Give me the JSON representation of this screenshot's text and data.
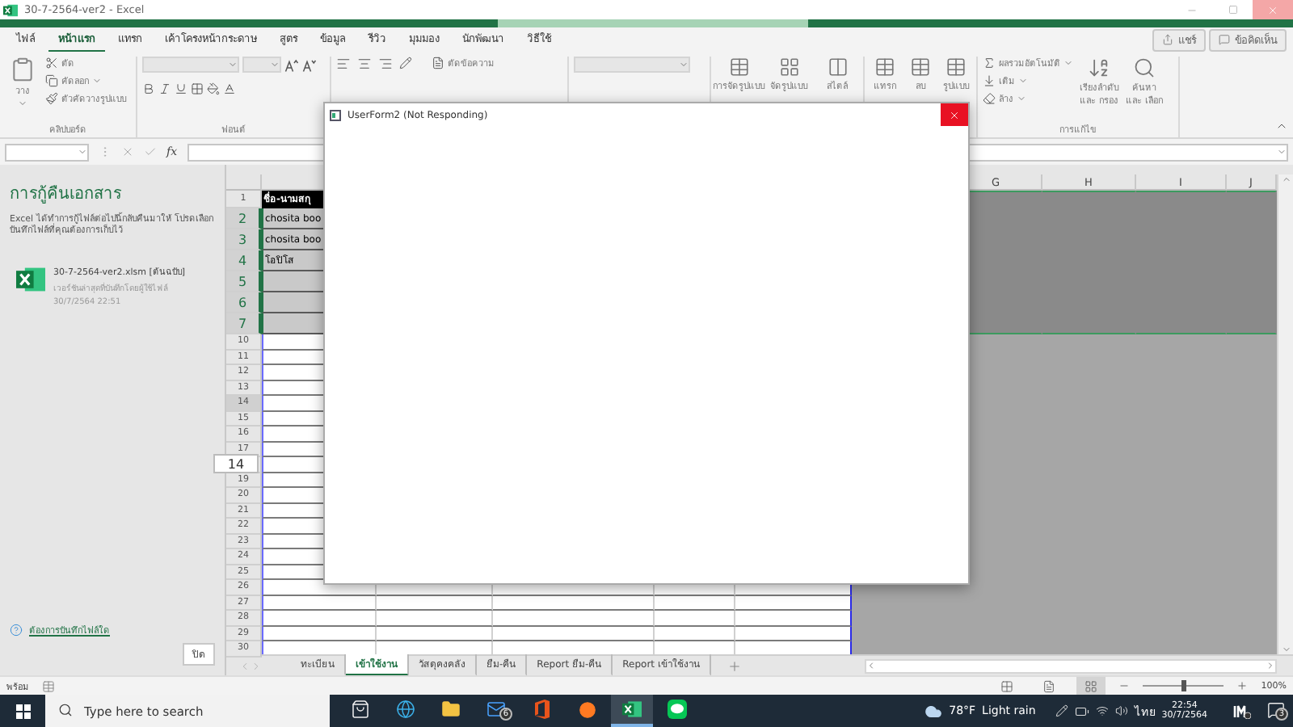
{
  "window": {
    "title": "30-7-2564-ver2 - Excel"
  },
  "ribbon_tabs": [
    {
      "label": "ไฟล์",
      "selected": false
    },
    {
      "label": "หน้าแรก",
      "selected": true
    },
    {
      "label": "แทรก",
      "selected": false
    },
    {
      "label": "เค้าโครงหน้ากระดาษ",
      "selected": false
    },
    {
      "label": "สูตร",
      "selected": false
    },
    {
      "label": "ข้อมูล",
      "selected": false
    },
    {
      "label": "รีวิว",
      "selected": false
    },
    {
      "label": "มุมมอง",
      "selected": false
    },
    {
      "label": "นักพัฒนา",
      "selected": false
    },
    {
      "label": "วิธีใช้",
      "selected": false
    }
  ],
  "share_button": "แชร์",
  "comments_button": "ข้อคิดเห็น",
  "ribbon": {
    "clipboard": {
      "paste": "วาง",
      "cut": "ตัด",
      "copy": "คัดลอก",
      "format_painter": "ตัวคัดวางรูปแบบ",
      "label": "คลิปบอร์ด"
    },
    "font": {
      "label": "ฟอนต์"
    },
    "alignment": {
      "wrap_text": "ตัดข้อความ"
    },
    "styles": [
      "การจัดรูปแบบ",
      "จัดรูปแบบ",
      "สไตล์"
    ],
    "cells": [
      "แทรก",
      "ลบ",
      "รูปแบบ"
    ],
    "editing": {
      "autosum": "ผลรวมอัตโนมัติ",
      "fill": "เติม",
      "clear": "ล้าง",
      "sort": "เรียงลำดับและ กรอง",
      "find": "ค้นหาและ เลือก",
      "label": "การแก้ไข"
    }
  },
  "formula_bar": {
    "function_label": "fx"
  },
  "recovery_pane": {
    "title": "การกู้คืนเอกสาร",
    "message": "Excel ได้ทำการกู้ไฟล์ต่อไปนี้กลับคืนมาให้ โปรดเลือกบันทึกไฟล์ที่คุณต้องการเก็บไว้",
    "files": [
      {
        "name": "30-7-2564-ver2.xlsm  [ต้นฉบับ]",
        "note": "เวอร์ชันล่าสุดที่บันทึกโดยผู้ใช้ไฟล์",
        "time": "30/7/2564 22:51"
      }
    ],
    "help_link": "ต้องการบันทึกไฟล์ใด",
    "close_button": "ปิด"
  },
  "sheet": {
    "column_headers": [
      "G",
      "H",
      "I",
      "J"
    ],
    "row_tooltip": "14",
    "rows": [
      {
        "header": "1",
        "kind": "heading",
        "cell": "ชื่อ-นามสกุ",
        "selected": false,
        "hovered": false
      },
      {
        "header": "2",
        "kind": "filled",
        "cell": "chosita boo",
        "selected": true,
        "hovered": false
      },
      {
        "header": "3",
        "kind": "filled",
        "cell": "chosita boo",
        "selected": true,
        "hovered": false
      },
      {
        "header": "4",
        "kind": "filled",
        "cell": "โอปิโส",
        "selected": true,
        "hovered": false
      },
      {
        "header": "5",
        "kind": "filled",
        "selected": true,
        "hovered": false
      },
      {
        "header": "6",
        "kind": "filled",
        "selected": true,
        "hovered": false
      },
      {
        "header": "7",
        "kind": "filled",
        "selected": true,
        "hovered": false
      },
      {
        "header": "10",
        "kind": "empty",
        "selected": false,
        "hovered": false
      },
      {
        "header": "11",
        "kind": "empty",
        "selected": false,
        "hovered": false
      },
      {
        "header": "12",
        "kind": "empty",
        "selected": false,
        "hovered": false
      },
      {
        "header": "13",
        "kind": "empty",
        "selected": false,
        "hovered": false
      },
      {
        "header": "14",
        "kind": "empty",
        "selected": false,
        "hovered": true
      },
      {
        "header": "15",
        "kind": "empty",
        "selected": false,
        "hovered": false
      },
      {
        "header": "16",
        "kind": "empty",
        "selected": false,
        "hovered": false
      },
      {
        "header": "17",
        "kind": "empty",
        "selected": false,
        "hovered": false
      },
      {
        "kind": "empty",
        "selected": false,
        "hovered": false,
        "tooltip": true
      },
      {
        "header": "19",
        "kind": "empty",
        "selected": false,
        "hovered": false
      },
      {
        "header": "20",
        "kind": "empty",
        "selected": false,
        "hovered": false
      },
      {
        "header": "21",
        "kind": "empty",
        "selected": false,
        "hovered": false
      },
      {
        "header": "22",
        "kind": "empty",
        "selected": false,
        "hovered": false
      },
      {
        "header": "23",
        "kind": "empty",
        "selected": false,
        "hovered": false
      },
      {
        "header": "24",
        "kind": "empty",
        "selected": false,
        "hovered": false
      },
      {
        "header": "25",
        "kind": "empty",
        "selected": false,
        "hovered": false
      },
      {
        "header": "26",
        "kind": "empty",
        "selected": false,
        "hovered": false
      },
      {
        "header": "27",
        "kind": "empty",
        "selected": false,
        "hovered": false
      },
      {
        "header": "28",
        "kind": "empty",
        "selected": false,
        "hovered": false
      },
      {
        "header": "29",
        "kind": "empty",
        "selected": false,
        "hovered": false
      },
      {
        "header": "30",
        "kind": "empty",
        "selected": false,
        "hovered": false
      }
    ]
  },
  "sheet_tabs": [
    {
      "label": "ทะเบียน",
      "selected": false
    },
    {
      "label": "เข้าใช้งาน",
      "selected": true
    },
    {
      "label": "วัสดุคงคลัง",
      "selected": false
    },
    {
      "label": "ยืม-คืน",
      "selected": false
    },
    {
      "label": "Report ยืม-คืน",
      "selected": false
    },
    {
      "label": "Report เข้าใช้งาน",
      "selected": false
    }
  ],
  "status_bar": {
    "status": "พร้อม",
    "views": [
      {
        "selected": false
      },
      {
        "selected": false
      },
      {
        "selected": true
      }
    ],
    "zoom": {
      "level": 0.5,
      "reading": "100%"
    }
  },
  "dialog": {
    "title": "UserForm2 (Not Responding)"
  },
  "taskbar": {
    "search": {
      "placeholder": "Type here to search"
    },
    "apps": [
      {
        "kind": "store",
        "active": false
      },
      {
        "kind": "browser",
        "active": false
      },
      {
        "kind": "folder",
        "active": false
      },
      {
        "kind": "mail",
        "active": false,
        "badge": "6"
      },
      {
        "kind": "office",
        "active": false
      },
      {
        "kind": "orange",
        "active": false
      },
      {
        "kind": "excel",
        "active": true
      },
      {
        "kind": "chat",
        "active": false
      }
    ],
    "weather": {
      "temperature": "78°F",
      "condition": "Light rain"
    },
    "language": "ไทย",
    "time": "22:54",
    "date": "30/7/2564",
    "notification_badge": "3"
  }
}
